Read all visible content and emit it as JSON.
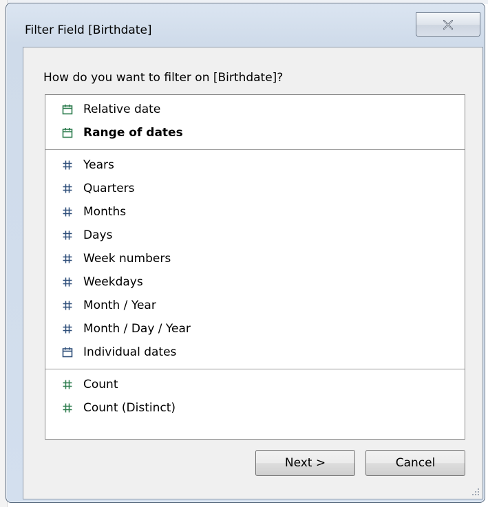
{
  "window": {
    "title": "Filter Field [Birthdate]"
  },
  "prompt": {
    "question": "How do you want to filter on [Birthdate]?"
  },
  "options": {
    "group1": [
      {
        "label": "Relative date",
        "icon": "calendar-icon",
        "bold": false
      },
      {
        "label": "Range of dates",
        "icon": "calendar-icon",
        "bold": true
      }
    ],
    "group2": [
      {
        "label": "Years",
        "icon": "hash-icon"
      },
      {
        "label": "Quarters",
        "icon": "hash-icon"
      },
      {
        "label": "Months",
        "icon": "hash-icon"
      },
      {
        "label": "Days",
        "icon": "hash-icon"
      },
      {
        "label": "Week numbers",
        "icon": "hash-icon"
      },
      {
        "label": "Weekdays",
        "icon": "hash-icon"
      },
      {
        "label": "Month / Year",
        "icon": "hash-icon"
      },
      {
        "label": "Month / Day / Year",
        "icon": "hash-icon"
      },
      {
        "label": "Individual dates",
        "icon": "calendar-icon"
      }
    ],
    "group3": [
      {
        "label": "Count",
        "icon": "hash-icon"
      },
      {
        "label": "Count (Distinct)",
        "icon": "hash-icon"
      }
    ]
  },
  "buttons": {
    "next_label": "Next >",
    "cancel_label": "Cancel"
  },
  "colors": {
    "green_icon": "#2e7d4f",
    "blue_icon": "#2f4f7a"
  }
}
